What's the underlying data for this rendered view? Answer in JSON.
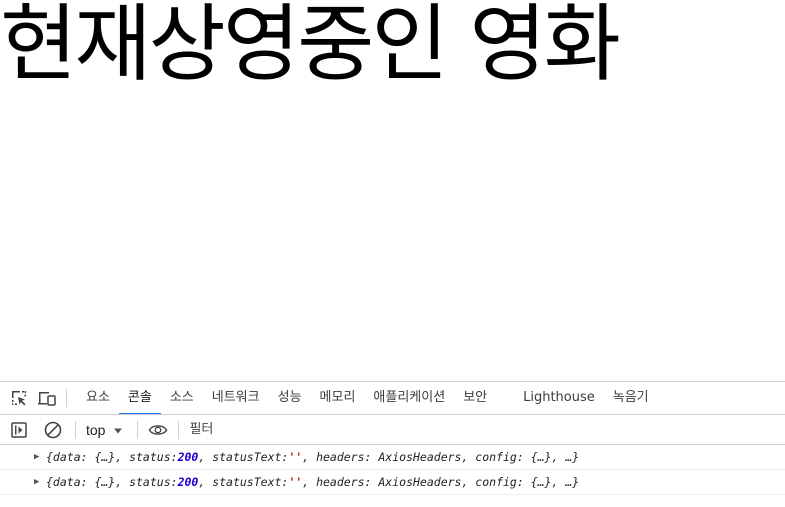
{
  "page": {
    "heading": "현재상영중인 영화"
  },
  "devtools": {
    "tabs": [
      {
        "label": "요소",
        "active": false
      },
      {
        "label": "콘솔",
        "active": true
      },
      {
        "label": "소스",
        "active": false
      },
      {
        "label": "네트워크",
        "active": false
      },
      {
        "label": "성능",
        "active": false
      },
      {
        "label": "메모리",
        "active": false
      },
      {
        "label": "애플리케이션",
        "active": false
      },
      {
        "label": "보안",
        "active": false
      },
      {
        "label": "Lighthouse",
        "active": false
      },
      {
        "label": "녹음기",
        "active": false
      }
    ],
    "toolbar": {
      "context": "top",
      "filter_placeholder": "필터"
    },
    "console_log": [
      {
        "prefix": "{data: {…}, status: ",
        "status": "200",
        "middle": ", statusText: ",
        "status_text": "''",
        "suffix": ", headers: AxiosHeaders, config: {…}, …}"
      },
      {
        "prefix": "{data: {…}, status: ",
        "status": "200",
        "middle": ", statusText: ",
        "status_text": "''",
        "suffix": ", headers: AxiosHeaders, config: {…}, …}"
      }
    ],
    "icons": [
      "inspect-element-icon",
      "device-toolbar-icon",
      "sidebar-toggle-icon",
      "clear-console-icon",
      "chevron-down-icon",
      "live-expression-eye-icon",
      "expand-arrow-icon"
    ]
  }
}
